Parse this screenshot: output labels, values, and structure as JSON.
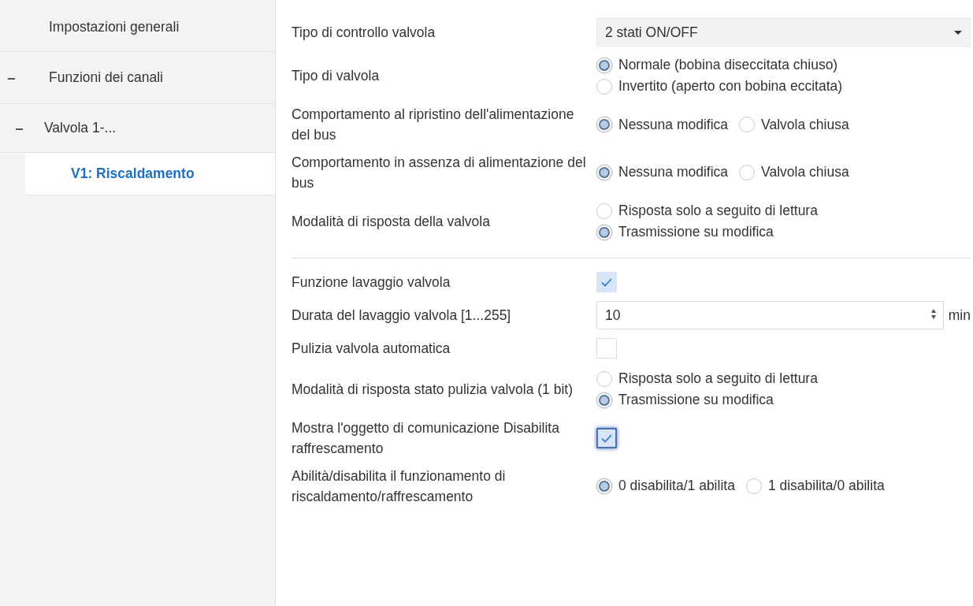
{
  "sidebar": {
    "items": [
      {
        "label": "Impostazioni generali",
        "selected": false
      },
      {
        "label": "Funzioni dei canali",
        "selected": false,
        "expanded": true,
        "children": [
          {
            "label": "Valvola 1-...",
            "selected": false,
            "expanded": true,
            "children": [
              {
                "label": "V1: Riscaldamento",
                "selected": true
              }
            ]
          }
        ]
      }
    ]
  },
  "params": [
    {
      "kind": "dropdown",
      "label": "Tipo di controllo valvola",
      "value": "2 stati ON/OFF"
    },
    {
      "kind": "radio-column",
      "label": "Tipo di valvola",
      "options": [
        {
          "label": "Normale (bobina diseccitata chiuso)",
          "selected": true
        },
        {
          "label": "Invertito (aperto con bobina eccitata)",
          "selected": false
        }
      ]
    },
    {
      "kind": "radio-row",
      "label": "Comportamento al ripristino dell'alimentazione del bus",
      "options": [
        {
          "label": "Nessuna modifica",
          "selected": true
        },
        {
          "label": "Valvola chiusa",
          "selected": false
        }
      ]
    },
    {
      "kind": "radio-row",
      "label": "Comportamento in assenza di alimentazione del bus",
      "options": [
        {
          "label": "Nessuna modifica",
          "selected": true
        },
        {
          "label": "Valvola chiusa",
          "selected": false
        }
      ]
    },
    {
      "kind": "radio-column",
      "label": "Modalità di risposta della valvola",
      "options": [
        {
          "label": "Risposta solo a seguito di lettura",
          "selected": false
        },
        {
          "label": "Trasmissione su modifica",
          "selected": true
        }
      ]
    },
    {
      "kind": "divider"
    },
    {
      "kind": "checkbox",
      "label": "Funzione lavaggio valvola",
      "checked": true,
      "focused": false
    },
    {
      "kind": "number",
      "label": "Durata del lavaggio valvola [1...255]",
      "value": "10",
      "unit": "min"
    },
    {
      "kind": "checkbox",
      "label": "Pulizia valvola automatica",
      "checked": false,
      "focused": false
    },
    {
      "kind": "radio-column",
      "label": "Modalità di risposta stato pulizia valvola (1 bit)",
      "options": [
        {
          "label": "Risposta solo a seguito di lettura",
          "selected": false
        },
        {
          "label": "Trasmissione su modifica",
          "selected": true
        }
      ]
    },
    {
      "kind": "checkbox",
      "label": "Mostra l'oggetto di comunicazione Disabilita raffrescamento",
      "checked": true,
      "focused": true
    },
    {
      "kind": "radio-row",
      "label": "Abilità/disabilita il funzionamento di riscaldamento/raffrescamento",
      "options": [
        {
          "label": "0 disabilita/1 abilita",
          "selected": true
        },
        {
          "label": "1 disabilita/0 abilita",
          "selected": false
        }
      ]
    }
  ]
}
